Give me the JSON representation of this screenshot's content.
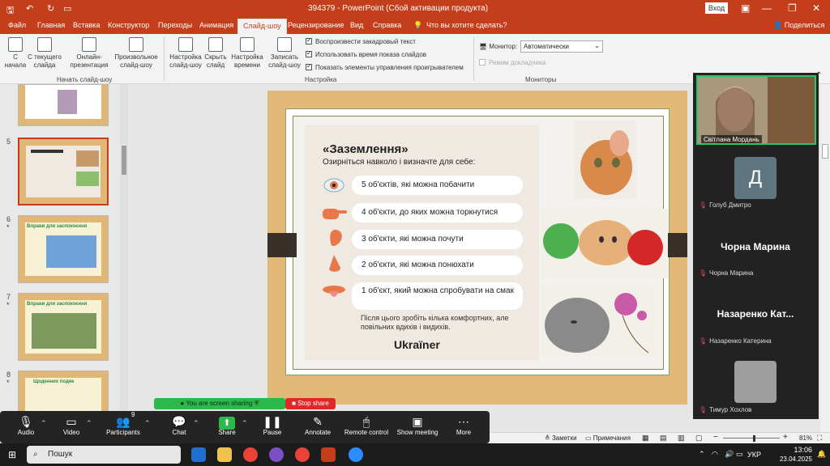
{
  "titlebar": {
    "doc": "394379",
    "title": "394379 - PowerPoint (Сбой активации продукта)",
    "login": "Вход"
  },
  "tabs": [
    "Файл",
    "Главная",
    "Вставка",
    "Конструктор",
    "Переходы",
    "Анимация",
    "Слайд-шоу",
    "Рецензирование",
    "Вид",
    "Справка",
    "Что вы хотите сделать?"
  ],
  "share_label": "Поделиться",
  "ribbon": {
    "start": [
      "С начала",
      "С текущего слайда",
      "Онлайн-презентация",
      "Произвольное слайд-шоу"
    ],
    "setup": [
      "Настройка слайд-шоу",
      "Скрыть слайд",
      "Настройка времени",
      "Записать слайд-шоу"
    ],
    "checks": [
      "Воспроизвести закадровый текст",
      "Использовать время показа слайдов",
      "Показать элементы управления проигрывателем"
    ],
    "monitor_label": "Монитор:",
    "monitor_value": "Автоматически",
    "presenter_mode": "Режим докладчика",
    "groups": [
      "Начать слайд-шоу",
      "Настройка",
      "Мониторы"
    ]
  },
  "thumbs": [
    {
      "num": "5"
    },
    {
      "num": "6",
      "title": "Вправи для заспокоєння"
    },
    {
      "num": "7",
      "title": "Вправи для заспокоєння"
    },
    {
      "num": "8",
      "title": "Щоденних подяк"
    }
  ],
  "slide": {
    "heading": "«Заземлення»",
    "subheading": "Озирніться навколо і визначте для себе:",
    "items": [
      "5 об'єктів, які можна побачити",
      "4 об'єкти, до яких можна торкнутися",
      "3 об'єкти, які можна почути",
      "2 об'єкти, які можна понюхати",
      "1 об'єкт, який можна спробувати на смак"
    ],
    "footer": "Після цього зробіть кілька комфортних, але повільних вдихів і видихів.",
    "brand": "Ukraïner"
  },
  "participants": [
    {
      "name": "Світлана Мордань"
    },
    {
      "name": "Голуб Дмитро",
      "initial": "Д"
    },
    {
      "name": "Чорна Марина",
      "display": "Чорна Марина"
    },
    {
      "name": "Назаренко Катерина",
      "display": "Назаренко  Кат..."
    },
    {
      "name": "Тимур Хохлов"
    }
  ],
  "status": {
    "notes": "Заметки",
    "comments": "Примечания",
    "zoom": "81%"
  },
  "zoom": {
    "sharing": "You are screen sharing",
    "stop": "Stop share",
    "participants_count": "9",
    "buttons": [
      "Audio",
      "Video",
      "Participants",
      "Chat",
      "Share",
      "Pause",
      "Annotate",
      "Remote control",
      "Show meeting",
      "More"
    ]
  },
  "taskbar": {
    "search": "Пошук",
    "lang": "УКР",
    "time": "13:06",
    "date": "23.04.2025"
  }
}
